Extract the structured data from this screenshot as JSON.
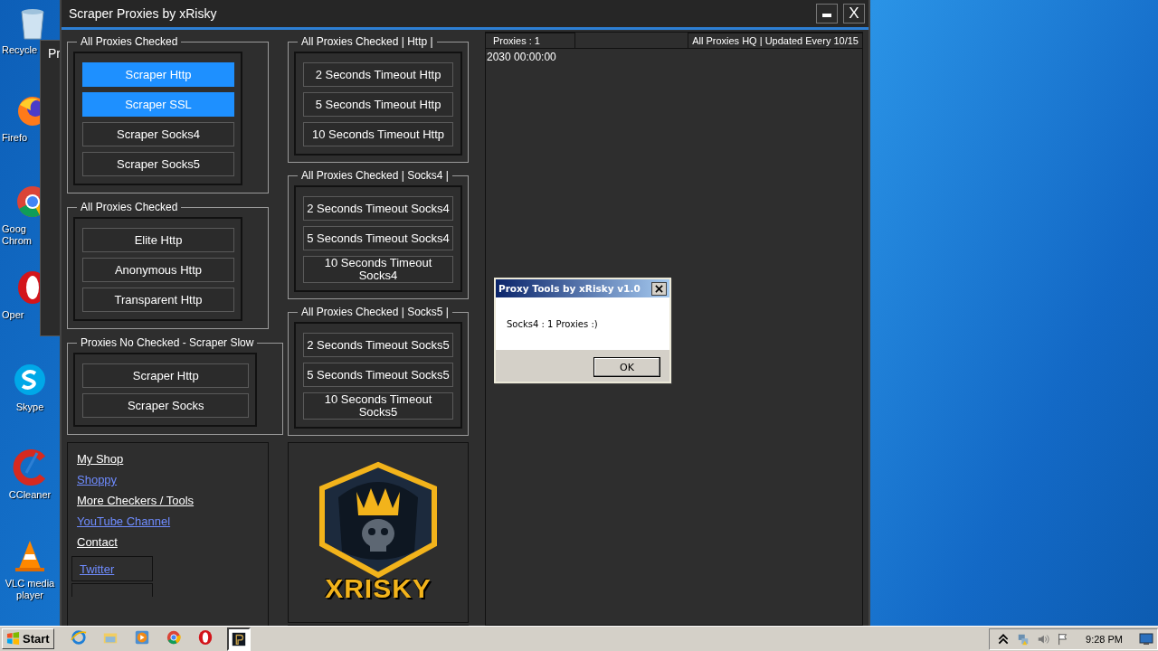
{
  "desktop": {
    "icons": [
      {
        "label": "Recycle",
        "kind": "recycle"
      },
      {
        "label": "Firefo",
        "kind": "firefox"
      },
      {
        "label": "Goog Chrom",
        "kind": "chrome"
      },
      {
        "label": "Oper",
        "kind": "opera"
      },
      {
        "label": "Skype",
        "kind": "skype"
      },
      {
        "label": "CCleaner",
        "kind": "ccleaner"
      },
      {
        "label": "VLC media player",
        "kind": "vlc"
      }
    ]
  },
  "background_window": {
    "title": "Pr"
  },
  "window": {
    "title": "Scraper Proxies by xRisky",
    "close": "X"
  },
  "left_groups": [
    {
      "title": "All Proxies Checked",
      "buttons": [
        {
          "label": "Scraper Http",
          "selected": true
        },
        {
          "label": "Scraper SSL",
          "selected": true
        },
        {
          "label": "Scraper Socks4",
          "selected": false
        },
        {
          "label": "Scraper Socks5",
          "selected": false
        }
      ]
    },
    {
      "title": "All Proxies Checked",
      "buttons": [
        {
          "label": "Elite Http",
          "selected": false
        },
        {
          "label": "Anonymous Http",
          "selected": false
        },
        {
          "label": "Transparent Http",
          "selected": false
        }
      ]
    },
    {
      "title": "Proxies No Checked - Scraper Slow",
      "buttons": [
        {
          "label": "Scraper Http",
          "selected": false
        },
        {
          "label": "Scraper Socks",
          "selected": false
        }
      ]
    }
  ],
  "links": [
    {
      "label": "My Shop",
      "kind": "bright"
    },
    {
      "label": "Shoppy",
      "kind": "dim"
    },
    {
      "label": "More Checkers / Tools",
      "kind": "bright"
    },
    {
      "label": "YouTube Channel",
      "kind": "dim"
    },
    {
      "label": "Contact",
      "kind": "bright"
    },
    {
      "label": "Twitter",
      "kind": "boxed"
    }
  ],
  "middle_groups": [
    {
      "title": "All Proxies Checked | Http |",
      "buttons": [
        {
          "label": "2 Seconds Timeout Http",
          "selected": false
        },
        {
          "label": "5 Seconds Timeout Http",
          "selected": false
        },
        {
          "label": "10 Seconds Timeout Http",
          "selected": false
        }
      ]
    },
    {
      "title": "All Proxies Checked | Socks4 |",
      "buttons": [
        {
          "label": "2 Seconds Timeout Socks4",
          "selected": false
        },
        {
          "label": "5 Seconds Timeout Socks4",
          "selected": false
        },
        {
          "label": "10 Seconds Timeout Socks4",
          "selected": false
        }
      ]
    },
    {
      "title": "All Proxies Checked | Socks5 |",
      "buttons": [
        {
          "label": "2 Seconds Timeout Socks5",
          "selected": false
        },
        {
          "label": "5 Seconds Timeout Socks5",
          "selected": false
        },
        {
          "label": "10 Seconds Timeout Socks5",
          "selected": false
        }
      ]
    }
  ],
  "logo": {
    "text": "XRISKY"
  },
  "log": {
    "tab": "Proxies : 1",
    "info": "All Proxies HQ | Updated Every 10/15",
    "lines": [
      "2030 00:00:00"
    ]
  },
  "dialog": {
    "title": "Proxy Tools by xRisky v1.0",
    "message": "Socks4 :  1 Proxies :)",
    "button": "OK"
  },
  "taskbar": {
    "start": "Start",
    "apps": [
      {
        "kind": "ie",
        "selected": false
      },
      {
        "kind": "folder",
        "selected": false
      },
      {
        "kind": "media",
        "selected": false
      },
      {
        "kind": "chrome",
        "selected": false
      },
      {
        "kind": "opera",
        "selected": false
      },
      {
        "kind": "app",
        "selected": true
      }
    ],
    "clock": "9:28 PM"
  }
}
